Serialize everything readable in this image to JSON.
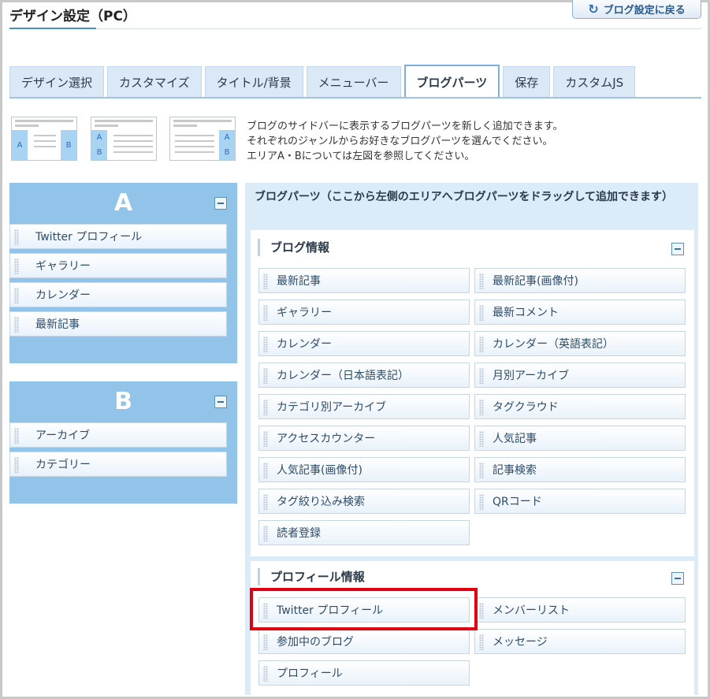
{
  "header": {
    "title": "デザイン設定（PC）",
    "back_button_label": "ブログ設定に戻る"
  },
  "tabs": [
    "デザイン選択",
    "カスタマイズ",
    "タイトル/背景",
    "メニューバー",
    "ブログパーツ",
    "保存",
    "カスタムJS"
  ],
  "active_tab": "ブログパーツ",
  "layout_thumbnails": {
    "t1": {
      "a": "A",
      "b": "B"
    },
    "t2": {
      "a": "A",
      "b": "B"
    },
    "t3": {
      "a": "A",
      "b": "B"
    }
  },
  "intro": {
    "line1": "ブログのサイドバーに表示するブログパーツを新しく追加できます。",
    "line2": "それぞれのジャンルからお好きなブログパーツを選んでください。",
    "line3": "エリアA・Bについては左図を参照してください。"
  },
  "area_a": {
    "letter": "A",
    "items": [
      "Twitter プロフィール",
      "ギャラリー",
      "カレンダー",
      "最新記事"
    ]
  },
  "area_b": {
    "letter": "B",
    "items": [
      "アーカイブ",
      "カテゴリー"
    ]
  },
  "parts_header": "ブログパーツ（ここから左側のエリアへブログパーツをドラッグして追加できます）",
  "blog_info": {
    "title": "ブログ情報",
    "parts": [
      "最新記事",
      "最新記事(画像付)",
      "ギャラリー",
      "最新コメント",
      "カレンダー",
      "カレンダー（英語表記）",
      "カレンダー（日本語表記）",
      "月別アーカイブ",
      "カテゴリ別アーカイブ",
      "タグクラウド",
      "アクセスカウンター",
      "人気記事",
      "人気記事(画像付)",
      "記事検索",
      "タグ絞り込み検索",
      "QRコード",
      "読者登録"
    ]
  },
  "profile_info": {
    "title": "プロフィール情報",
    "parts": [
      "Twitter プロフィール",
      "メンバーリスト",
      "参加中のブログ",
      "メッセージ",
      "プロフィール"
    ]
  },
  "colors": {
    "area_bg": "#92c4ea",
    "panel_bg": "#dcebf8",
    "highlight": "#e0000f"
  }
}
